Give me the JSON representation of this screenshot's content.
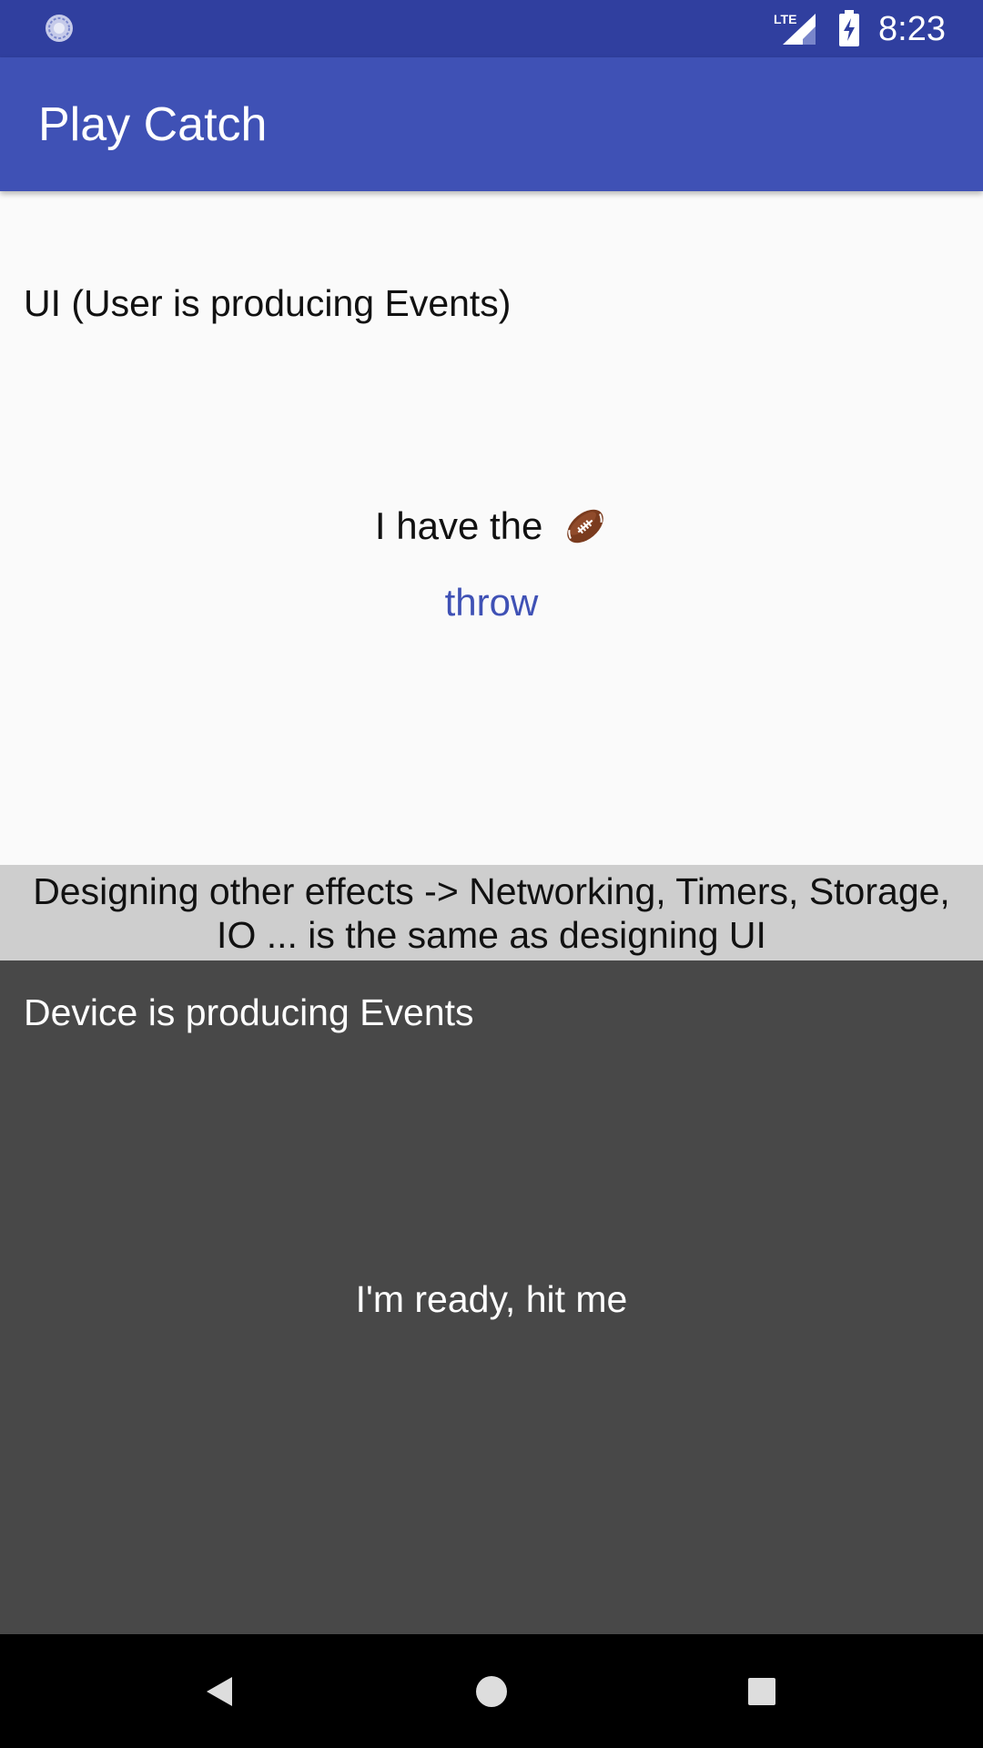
{
  "status_bar": {
    "time": "8:23",
    "network": "LTE",
    "left_icon": "sync-icon",
    "battery_icon": "battery-charging-icon",
    "bg_color": "#303f9f"
  },
  "app_bar": {
    "title": "Play Catch",
    "bg_color": "#3f51b5"
  },
  "ui_section": {
    "label": "UI (User is producing Events)",
    "status_text": "I have the",
    "status_icon": "football-icon",
    "throw_label": "throw",
    "accent_color": "#3f51b5"
  },
  "divider": {
    "line1": "Designing other effects -> Networking, Timers, Storage,",
    "line2": "IO ... is the same as designing UI"
  },
  "device_section": {
    "label": "Device is producing Events",
    "status_text": "I'm ready, hit me",
    "bg_color": "#484848"
  },
  "nav_bar": {
    "back_icon": "back-triangle-icon",
    "home_icon": "home-circle-icon",
    "recents_icon": "recents-square-icon"
  }
}
